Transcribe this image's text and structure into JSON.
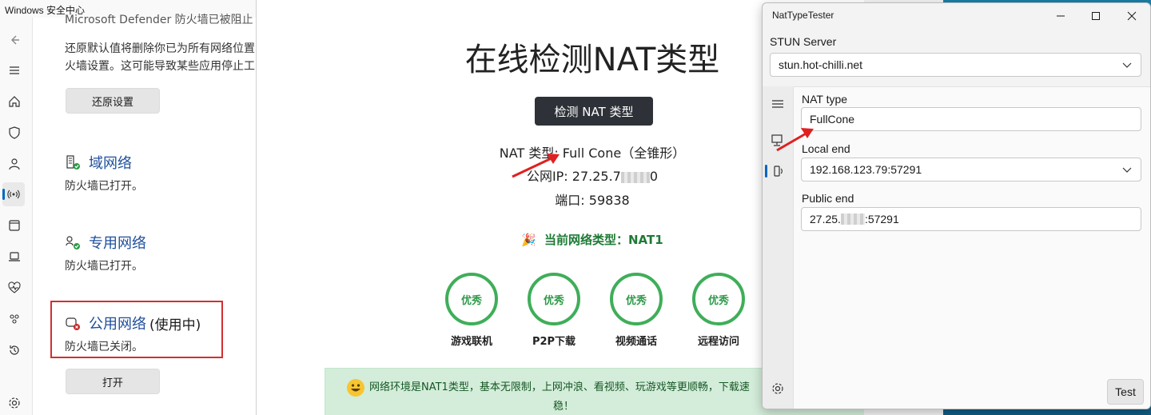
{
  "windows_security": {
    "title": "Windows 安全中心",
    "top_cut_text": "Microsoft Defender 防火墙已被阻止",
    "restore_desc_line1": "还原默认值将删除你已为所有网络位置",
    "restore_desc_line2": "火墙设置。这可能导致某些应用停止工",
    "restore_button": "还原设置",
    "networks": [
      {
        "name": "域网络",
        "status": "防火墙已打开。",
        "in_use": ""
      },
      {
        "name": "专用网络",
        "status": "防火墙已打开。",
        "in_use": ""
      },
      {
        "name": "公用网络",
        "status": "防火墙已关闭。",
        "in_use": "(使用中)"
      }
    ],
    "open_button": "打开",
    "nav_icons": [
      "back-arrow-icon",
      "menu-icon",
      "home-icon",
      "shield-icon",
      "person-icon",
      "network-icon",
      "app-browser-icon",
      "device-icon",
      "health-icon",
      "family-icon",
      "history-icon",
      "settings-icon"
    ]
  },
  "web": {
    "title": "在线检测NAT类型",
    "detect_button": "检测 NAT 类型",
    "nat_type_line": "NAT 类型: Full Cone（全锥形）",
    "public_ip_line": "公网IP: 27.25.7",
    "public_ip_suffix": "0",
    "port_line": "端口: 59838",
    "current_network": "当前网络类型：NAT1",
    "scores": [
      {
        "grade": "优秀",
        "label": "游戏联机"
      },
      {
        "grade": "优秀",
        "label": "P2P下载"
      },
      {
        "grade": "优秀",
        "label": "视频通话"
      },
      {
        "grade": "优秀",
        "label": "远程访问"
      }
    ],
    "status_message_line1": "网络环境是NAT1类型，基本无限制，上网冲浪、看视频、玩游戏等更顺畅，下载速",
    "status_message_line2": "稳！",
    "colors": {
      "good": "#3fae59",
      "status_bg": "#d4edda"
    }
  },
  "nat_tester": {
    "title": "NatTypeTester",
    "stun_label": "STUN Server",
    "stun_value": "stun.hot-chilli.net",
    "nat_type_label": "NAT type",
    "nat_type_value": "FullCone",
    "local_end_label": "Local end",
    "local_end_value": "192.168.123.79:57291",
    "public_end_label": "Public end",
    "public_end_prefix": "27.25.",
    "public_end_suffix": ":57291",
    "test_button": "Test"
  }
}
